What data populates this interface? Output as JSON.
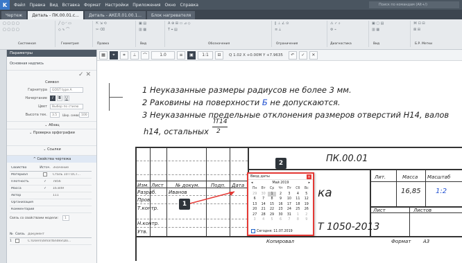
{
  "menubar": {
    "logo": "K",
    "items": [
      "Файл",
      "Правка",
      "Вид",
      "Вставка",
      "Формат",
      "Настройки",
      "Приложения",
      "Окно",
      "Справка"
    ],
    "search_placeholder": "Поиск по командам (Alt+/)"
  },
  "tabs": [
    "Чертеж",
    "Деталь - ПК.00.01.c...",
    "Деталь - АКЕЛ.01.00.1...",
    "Блок нагревателя"
  ],
  "ribbon": {
    "groups": [
      "Системная",
      "Геометрия",
      "Правка",
      "Вид",
      "Обозначения",
      "Ограничения",
      "Диагностика",
      "Вид",
      "Б.Р. Метки"
    ]
  },
  "toolstrip": {
    "scale": "1.0",
    "coords": "1:1",
    "zoom_text": "Q  1.02  X +0.00M  Y +7.9635"
  },
  "panel": {
    "title": "Параметры",
    "subtitle": "Основная надпись",
    "section_symbol": "Символ",
    "font_label": "Гарнитура",
    "font_value": "GOST type A",
    "style_label": "Начертание",
    "color_label": "Цвет",
    "color_value": "Выбор по стилю",
    "height_label": "Высота тек.",
    "height_value": "3.5",
    "width_label": "Шир. символа",
    "width_value": "1",
    "pct_value": "100",
    "abzac": "Абзац",
    "spell": "Проверка орфографии",
    "links": "Ссылки",
    "props": "Свойства чертежа",
    "table_headers": [
      "Свойство",
      "Источ.",
      "Значение"
    ],
    "props_rows": [
      {
        "name": "Материал",
        "src": "",
        "value": "Сталь 10 ГОСТ..."
      },
      {
        "name": "Плотность",
        "src": "✓",
        "value": "7856"
      },
      {
        "name": "Масса",
        "src": "✓",
        "value": "16.849"
      },
      {
        "name": "Автор",
        "src": "",
        "value": "111"
      },
      {
        "name": "Организация",
        "src": "",
        "value": ""
      },
      {
        "name": "Комментарий",
        "src": "",
        "value": ""
      }
    ],
    "link_label": "Связь со свойствами модели:",
    "link_value": "1",
    "doc_header": [
      "№",
      "Связь",
      "Документ"
    ],
    "doc_row": {
      "num": "1",
      "doc": "C:\\Users\\dima\\Yandex\\Do..."
    }
  },
  "notes": {
    "line1": "1 Неуказанные размеры радиусов не более 3 мм.",
    "line2a": "2 Раковины на поверхности ",
    "line2b": "Б",
    "line2c": " не допускаются.",
    "line3": "3 Неуказанные предельные отклонения размеров отверстий H14, валов",
    "line4": "h14, остальных",
    "frac_top": "IT14",
    "frac_bot": "2"
  },
  "stamp": {
    "doc_code": "ПК.00.01",
    "col_izm": "Изм.",
    "col_list": "Лист",
    "col_ndoc": "№ докум.",
    "col_podp": "Подп.",
    "col_data": "Дата",
    "razrab": "Разраб.",
    "razrab_name": "Иванов",
    "prov": "Пров.",
    "tkontr": "Т.контр.",
    "nkontr": "Н.контр.",
    "utv": "Утв.",
    "lit": "Лит.",
    "massa": "Масса",
    "masshtab": "Масштаб",
    "massa_val": "16,85",
    "masshtab_val": "1:2",
    "list": "Лист",
    "listov": "Листов",
    "name_partial": "ка",
    "gost": "Т 1050-2013",
    "kopiroval": "Копировал",
    "format": "Формат",
    "format_val": "A3"
  },
  "callouts": [
    "1",
    "2"
  ],
  "calendar": {
    "title": "Ввод даты",
    "month": "Май 2019",
    "weekdays": [
      "Пн",
      "Вт",
      "Ср",
      "Чт",
      "Пт",
      "Сб",
      "Вс"
    ],
    "days": [
      "29",
      "30",
      "1",
      "2",
      "3",
      "4",
      "5",
      "6",
      "7",
      "8",
      "9",
      "10",
      "11",
      "12",
      "13",
      "14",
      "15",
      "16",
      "17",
      "18",
      "19",
      "20",
      "21",
      "22",
      "23",
      "24",
      "25",
      "26",
      "27",
      "28",
      "29",
      "30",
      "31",
      "1",
      "2",
      "3",
      "4",
      "5",
      "6",
      "7",
      "8",
      "9"
    ],
    "today": "Сегодня: 11.07.2019"
  }
}
